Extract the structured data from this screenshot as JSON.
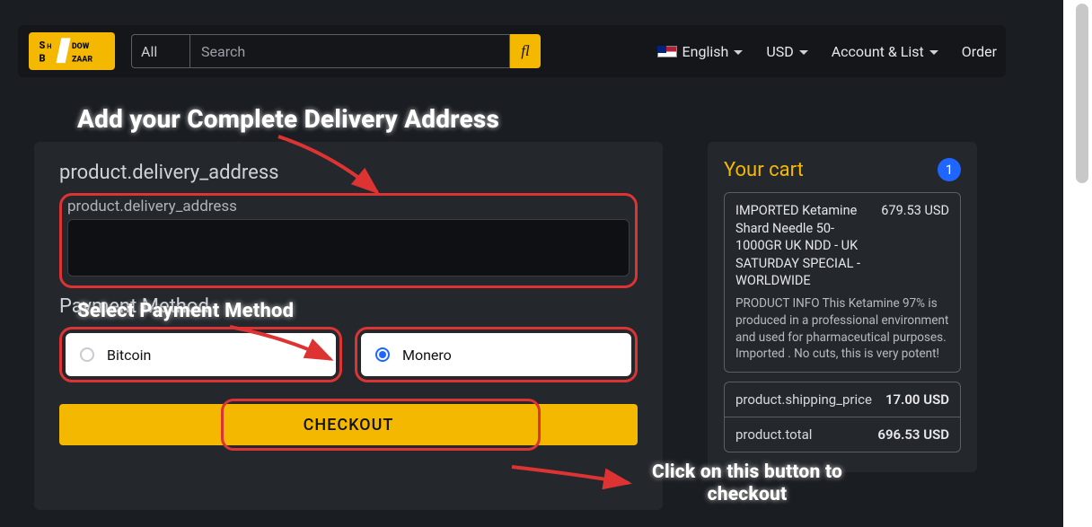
{
  "nav": {
    "all": "All",
    "search_placeholder": "Search",
    "lang": "English",
    "currency": "USD",
    "account": "Account & List",
    "order": "Order"
  },
  "main": {
    "address_title": "product.delivery_address",
    "address_field_label": "product.delivery_address",
    "payment_title": "Payment Method",
    "options": {
      "bitcoin": "Bitcoin",
      "monero": "Monero"
    },
    "checkout": "CHECKOUT"
  },
  "cart": {
    "title": "Your cart",
    "count": "1",
    "item": {
      "name": "IMPORTED Ketamine Shard Needle 50-1000GR UK NDD - UK SATURDAY SPECIAL - WORLDWIDE",
      "price": "679.53 USD",
      "desc": "PRODUCT INFO This Ketamine 97% is produced in a professional environment and used for pharmaceutical purposes. Imported . No cuts, this is very potent!"
    },
    "shipping_label": "product.shipping_price",
    "shipping_val": "17.00 USD",
    "total_label": "product.total",
    "total_val": "696.53 USD"
  },
  "anno": {
    "a1": "Add your Complete Delivery Address",
    "a2": "Select Payment Method",
    "a3": "Click on this button to checkout"
  }
}
